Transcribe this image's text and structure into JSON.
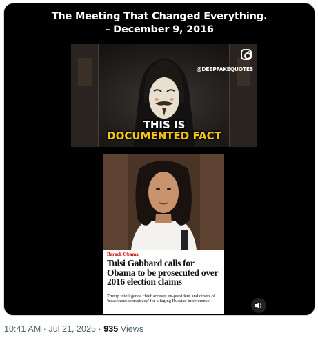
{
  "media": {
    "headline_line1": "The Meeting That Changed Everything.",
    "headline_line2": "– December 9, 2016",
    "video_frame": {
      "handle": "@DEEPFAKEQUOTES",
      "overlay_line1": "THIS IS",
      "overlay_line2": "DOCUMENTED FACT",
      "icon": "instagram-icon",
      "overlay_highlight_color": "#f5c518"
    },
    "news_card": {
      "kicker": "Barack Obama",
      "title": "Tulsi Gabbard calls for Obama to be prosecuted over 2016 election claims",
      "subtitle": "Trump intelligence chief accuses ex-president and others of 'treasonous conspiracy' for alleging Russian interference",
      "kicker_color": "#c70000"
    },
    "sound_icon": "speaker-icon"
  },
  "meta": {
    "time": "10:41 AM",
    "separator": "·",
    "date": "Jul 21, 2025",
    "views_count": "935",
    "views_label": "Views"
  }
}
